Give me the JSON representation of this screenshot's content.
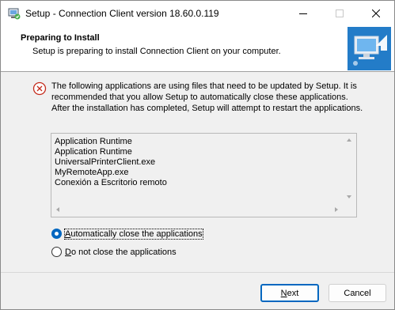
{
  "window": {
    "title": "Setup - Connection Client version 18.60.0.119"
  },
  "header": {
    "title": "Preparing to Install",
    "subtitle": "Setup is preparing to install Connection Client on your computer."
  },
  "message": "The following applications are using files that need to be updated by Setup. It is recommended that you allow Setup to automatically close these applications. After the installation has completed, Setup will attempt to restart the applications.",
  "applications": [
    "Application Runtime",
    "Application Runtime",
    "UniversalPrinterClient.exe",
    "MyRemoteApp.exe",
    "Conexión a Escritorio remoto"
  ],
  "options": {
    "auto_close": {
      "mnemonic": "A",
      "rest": "utomatically close the applications",
      "selected": true
    },
    "do_not_close": {
      "mnemonic": "D",
      "rest": "o not close the applications",
      "selected": false
    }
  },
  "buttons": {
    "next": {
      "mnemonic": "N",
      "rest": "ext"
    },
    "cancel": "Cancel"
  },
  "colors": {
    "accent": "#0067c0",
    "error_icon": "#c42b1c"
  },
  "icons": {
    "app": "setup-installer-icon",
    "wizard": "computer-arrow-icon",
    "warning": "error-circle-x-icon"
  }
}
